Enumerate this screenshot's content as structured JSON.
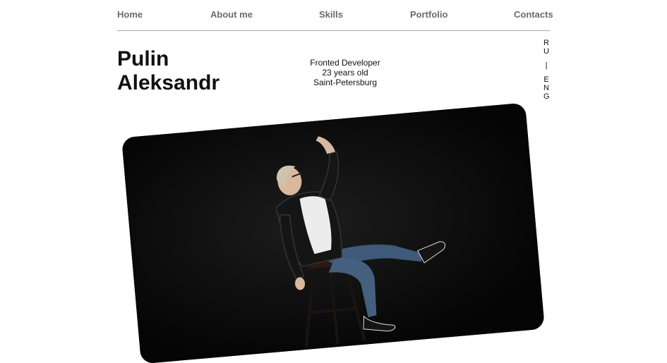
{
  "nav": {
    "items": [
      "Home",
      "About me",
      "Skills",
      "Portfolio",
      "Contacts"
    ]
  },
  "hero": {
    "first_name": "Pulin",
    "last_name": "Aleksandr",
    "role": "Fronted Developer",
    "age": "23 years old",
    "city": "Saint-Petersburg"
  },
  "lang": {
    "ru": "RU",
    "separator": "|",
    "eng": "ENG"
  },
  "photo": {
    "subject": "portrait-photo"
  },
  "colors": {
    "nav_text": "#6b6b6b",
    "text": "#111111",
    "divider": "#a8a8a8",
    "photo_bg": "#070707"
  }
}
